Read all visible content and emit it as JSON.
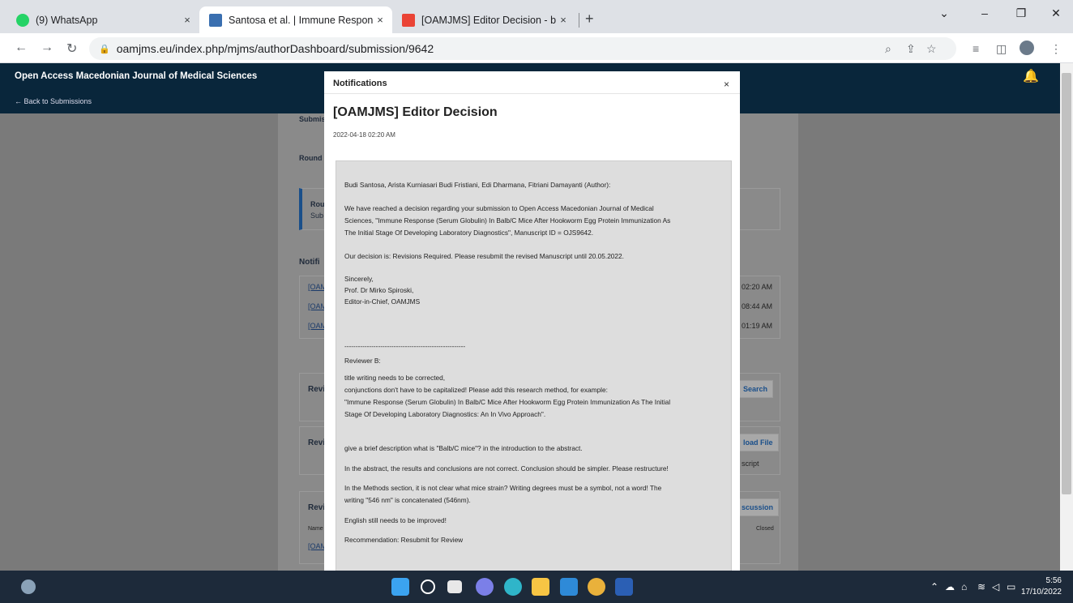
{
  "browser": {
    "tabs": [
      {
        "title": "(9) WhatsApp",
        "close": "×"
      },
      {
        "title": "Santosa et al. | Immune Respons",
        "close": "×"
      },
      {
        "title": "[OAMJMS] Editor Decision - budi",
        "close": "×"
      }
    ],
    "new_tab": "+",
    "url": "oamjms.eu/index.php/mjms/authorDashboard/submission/9642"
  },
  "ojs": {
    "journal_title": "Open Access Macedonian Journal of Medical Sciences",
    "back_link": "← Back to Submissions"
  },
  "background": {
    "submission_tab": "Submis",
    "round_tab": "Round",
    "round_notice_1": "Rou",
    "round_notice_2": "Sub",
    "notifications_heading": "Notifi",
    "notif_rows": [
      {
        "link": "[OAM",
        "time": "02:20 AM"
      },
      {
        "link": "[OAM",
        "time": "08:44 AM"
      },
      {
        "link": "[OAM",
        "time": "01:19 AM"
      }
    ],
    "review_files_label": "Revi",
    "search_btn": "Search",
    "revised_files_label": "Revi",
    "upload_btn": "load File",
    "script_text": "script",
    "review_disc_label": "Revi",
    "discussion_btn": "scussion",
    "name_col": "Name",
    "closed_col": "Closed",
    "disc_link": "[OAM"
  },
  "modal": {
    "header": "Notifications",
    "close": "×",
    "title": "[OAMJMS] Editor Decision",
    "date": "2022-04-18 02:20 AM",
    "lines": [
      "Budi Santosa, Arista Kurniasari Budi Fristiani, Edi Dharmana, Fitriani Damayanti (Author):",
      "We have reached a decision regarding your submission to Open Access Macedonian Journal of Medical",
      "Sciences, \"Immune Response (Serum Globulin) In Balb/C Mice After Hookworm Egg Protein Immunization As",
      "The Initial Stage Of Developing Laboratory Diagnostics\", Manuscript ID = OJS9642.",
      "Our decision is: Revisions Required. Please resubmit the revised Manuscript until 20.05.2022.",
      "Sincerely,",
      "Prof. Dr Mirko Spiroski,",
      "Editor-in-Chief, OAMJMS",
      "------------------------------------------------------",
      "Reviewer B:",
      "title writing needs to be corrected,",
      "conjunctions don't have to be capitalized! Please add this research method, for example:",
      "\"Immune Response (Serum Globulin) In Balb/C Mice After Hookworm Egg Protein Immunization As The Initial",
      "Stage Of Developing Laboratory Diagnostics: An In Vivo Approach\".",
      "give a brief description what is \"Balb/C mice\"? in the introduction to the abstract.",
      "In the abstract, the results and conclusions are not correct. Conclusion should be simpler. Please restructure!",
      "In the Methods section, it is not clear what mice strain? Writing degrees must be a symbol, not a word! The",
      "writing \"546 nm\" is concatenated (546nm).",
      "English still needs to be improved!",
      "Recommendation: Resubmit for Review"
    ]
  },
  "taskbar": {
    "time": "5:56",
    "date": "17/10/2022"
  },
  "colors": {
    "ojs_header": "#09263b",
    "overlay": "#7a7a7a",
    "taskbar": "#1d2a3a"
  }
}
